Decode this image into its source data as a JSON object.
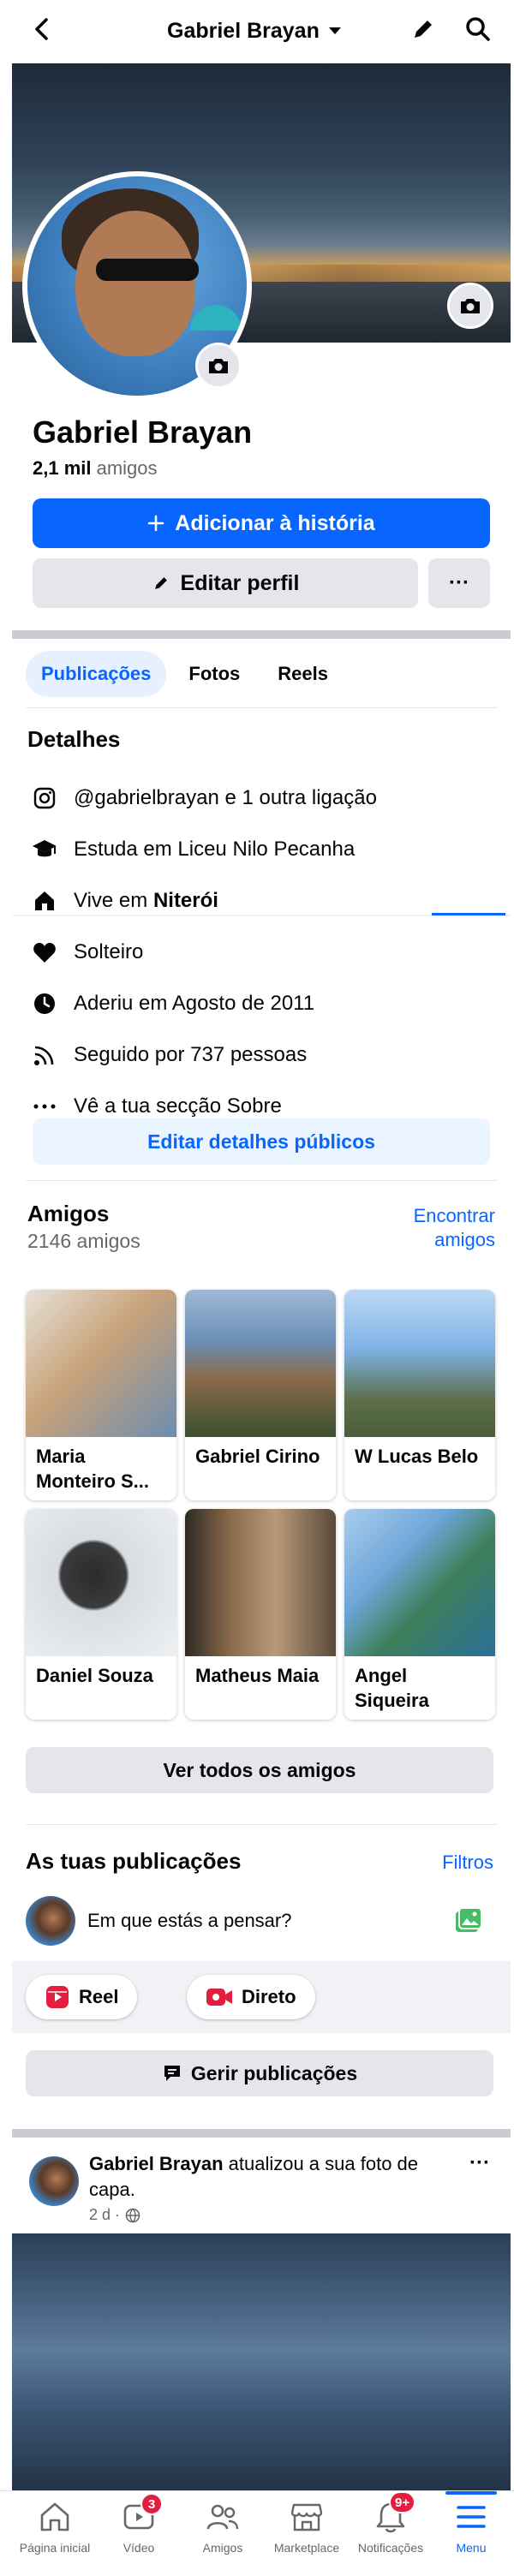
{
  "header": {
    "title": "Gabriel Brayan"
  },
  "profile": {
    "name": "Gabriel Brayan",
    "friends_count": "2,1 mil",
    "friends_word": "amigos",
    "add_story_label": "Adicionar à história",
    "edit_profile_label": "Editar perfil",
    "more_label": "···"
  },
  "tabs": [
    {
      "label": "Publicações",
      "active": true
    },
    {
      "label": "Fotos",
      "active": false
    },
    {
      "label": "Reels",
      "active": false
    }
  ],
  "details": {
    "title": "Detalhes",
    "items": [
      {
        "icon": "instagram-icon",
        "text": "@gabrielbrayan e 1 outra ligação"
      },
      {
        "icon": "graduation-cap-icon",
        "text": "Estuda em Liceu Nilo Pecanha"
      },
      {
        "icon": "home-icon",
        "prefix": "Vive em ",
        "bold": "Niterói"
      },
      {
        "icon": "heart-icon",
        "text": "Solteiro"
      },
      {
        "icon": "clock-icon",
        "text": "Aderiu em Agosto de 2011"
      },
      {
        "icon": "rss-icon",
        "text": "Seguido por 737 pessoas"
      },
      {
        "icon": "ellipsis-icon",
        "text": "Vê a tua secção Sobre"
      }
    ],
    "edit_button": "Editar detalhes públicos"
  },
  "friends": {
    "title": "Amigos",
    "count": "2146 amigos",
    "find_link_line1": "Encontrar",
    "find_link_line2": "amigos",
    "cards": [
      {
        "name": "Maria Monteiro S...",
        "colors": [
          "#c9a27a",
          "#6c8db0"
        ]
      },
      {
        "name": "Gabriel Cirino",
        "colors": [
          "#6b8fb5",
          "#3b4f2e"
        ]
      },
      {
        "name": "W Lucas Belo",
        "colors": [
          "#7fb2e5",
          "#4a5d3c"
        ]
      },
      {
        "name": "Daniel Souza",
        "colors": [
          "#d8dde2",
          "#2b2b2b"
        ]
      },
      {
        "name": "Matheus Maia",
        "colors": [
          "#8a6a4a",
          "#2e2a26"
        ]
      },
      {
        "name": "Angel Siqueira",
        "colors": [
          "#6ea6d8",
          "#3d7f5a"
        ]
      }
    ],
    "see_all": "Ver todos os amigos"
  },
  "posts": {
    "title": "As tuas publicações",
    "filters": "Filtros",
    "composer_placeholder": "Em que estás a pensar?",
    "reel_label": "Reel",
    "live_label": "Direto",
    "manage_label": "Gerir publicações"
  },
  "post": {
    "author": "Gabriel Brayan",
    "action": " atualizou a sua foto de capa.",
    "time": "2 d ·",
    "more": "···"
  },
  "bottom_nav": [
    {
      "icon": "home-icon",
      "label": "Página inicial",
      "badge": ""
    },
    {
      "icon": "video-icon",
      "label": "Vídeo",
      "badge": "3"
    },
    {
      "icon": "friends-icon",
      "label": "Amigos",
      "badge": ""
    },
    {
      "icon": "marketplace-icon",
      "label": "Marketplace",
      "badge": ""
    },
    {
      "icon": "bell-icon",
      "label": "Notificações",
      "badge": "9+"
    },
    {
      "icon": "menu-icon",
      "label": "Menu",
      "badge": "",
      "active": true
    }
  ],
  "colors": {
    "accent": "#0866ff",
    "badge": "#e41e3f",
    "divider": "#c9ccd1"
  }
}
